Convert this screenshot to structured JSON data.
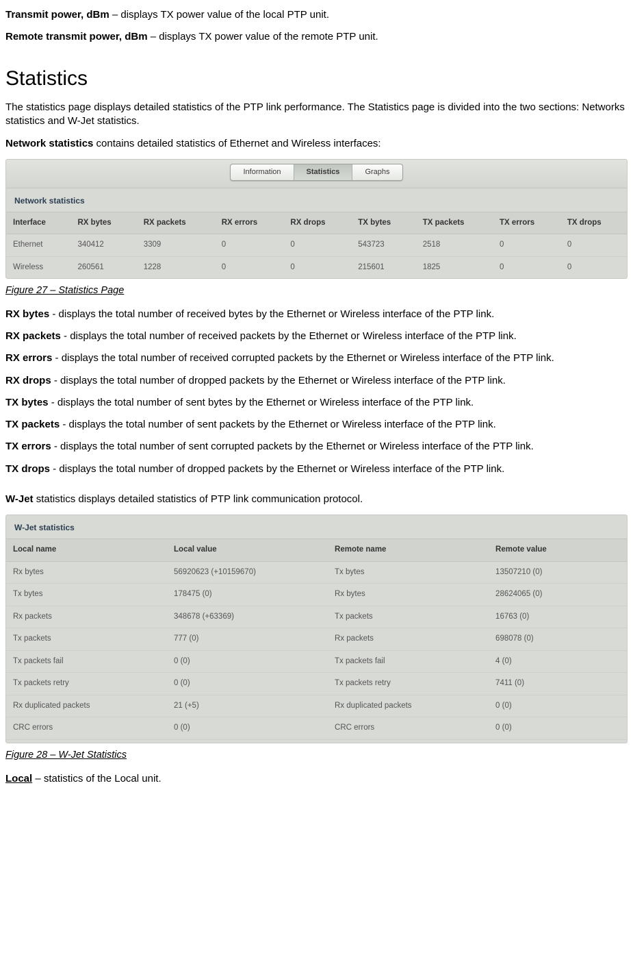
{
  "intro": {
    "txpower_term": "Transmit power, dBm",
    "txpower_desc": " – displays TX power value of the local PTP unit.",
    "remote_txpower_term": "Remote transmit power, dBm",
    "remote_txpower_desc": " – displays TX power value of the remote PTP unit."
  },
  "heading": "Statistics",
  "para_intro": "The statistics page displays detailed statistics of the PTP link performance. The Statistics page is divided into the two sections: Networks statistics and W-Jet statistics.",
  "netstats_lead_term": "Network statistics",
  "netstats_lead_rest": " contains detailed statistics of Ethernet and Wireless interfaces:",
  "tabs": {
    "info": "Information",
    "stats": "Statistics",
    "graphs": "Graphs"
  },
  "netstats": {
    "title": "Network statistics",
    "cols": [
      "Interface",
      "RX bytes",
      "RX packets",
      "RX errors",
      "RX drops",
      "TX bytes",
      "TX packets",
      "TX errors",
      "TX drops"
    ],
    "rows": [
      [
        "Ethernet",
        "340412",
        "3309",
        "0",
        "0",
        "543723",
        "2518",
        "0",
        "0"
      ],
      [
        "Wireless",
        "260561",
        "1228",
        "0",
        "0",
        "215601",
        "1825",
        "0",
        "0"
      ]
    ]
  },
  "figure27": "Figure 27 – Statistics Page",
  "defs": [
    {
      "term": "RX bytes",
      "text": " - displays the total number of received bytes by the Ethernet or Wireless interface of the PTP link."
    },
    {
      "term": "RX packets",
      "text": " - displays the total number of received packets by the Ethernet or Wireless interface of the PTP link."
    },
    {
      "term": "RX errors",
      "text": " - displays the total number of received corrupted packets by the Ethernet or Wireless interface of the PTP link."
    },
    {
      "term": "RX drops",
      "text": " - displays the total number of dropped packets by the Ethernet or Wireless interface of the PTP link."
    },
    {
      "term": "TX bytes",
      "text": " - displays the total number of sent bytes by the Ethernet or Wireless interface of the PTP link."
    },
    {
      "term": "TX packets",
      "text": " - displays the total number of sent packets by the Ethernet or Wireless interface of the PTP link."
    },
    {
      "term": "TX errors",
      "text": " - displays the total number of sent corrupted packets by the Ethernet or Wireless interface of the PTP link."
    },
    {
      "term": "TX drops",
      "text": " - displays the total number of dropped packets by the Ethernet or Wireless interface of the PTP link."
    }
  ],
  "wjet_lead_term": "W-Jet",
  "wjet_lead_rest": " statistics displays detailed statistics of PTP link communication protocol.",
  "wjet": {
    "title": "W-Jet statistics",
    "cols": [
      "Local name",
      "Local value",
      "Remote name",
      "Remote value"
    ],
    "rows": [
      [
        "Rx bytes",
        "56920623 (+10159670)",
        "Tx bytes",
        "13507210 (0)"
      ],
      [
        "Tx bytes",
        "178475 (0)",
        "Rx bytes",
        "28624065 (0)"
      ],
      [
        "Rx packets",
        "348678 (+63369)",
        "Tx packets",
        "16763 (0)"
      ],
      [
        "Tx packets",
        "777 (0)",
        "Rx packets",
        "698078 (0)"
      ],
      [
        "Tx packets fail",
        "0 (0)",
        "Tx packets fail",
        "4 (0)"
      ],
      [
        "Tx packets retry",
        "0 (0)",
        "Tx packets retry",
        "7411 (0)"
      ],
      [
        "Rx duplicated packets",
        "21 (+5)",
        "Rx duplicated packets",
        "0 (0)"
      ],
      [
        "CRC errors",
        "0 (0)",
        "CRC errors",
        "0 (0)"
      ]
    ]
  },
  "figure28": "Figure 28 – W-Jet Statistics",
  "local_term": "Local",
  "local_rest": " – statistics of the Local unit."
}
